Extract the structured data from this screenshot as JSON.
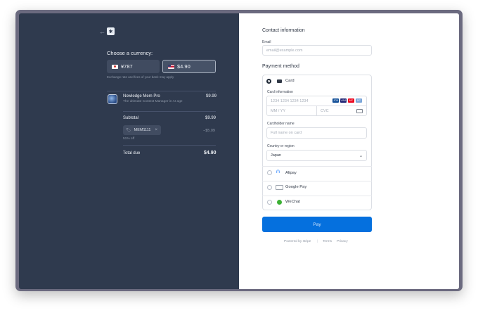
{
  "left": {
    "choose_label": "Choose a currency:",
    "currencies": [
      {
        "flag": "jp",
        "label": "¥787"
      },
      {
        "flag": "us",
        "label": "$4.90",
        "selected": true
      }
    ],
    "exchange_note": "Exchange rate and fees of your bank may apply",
    "product": {
      "name": "Nowledge Mem Pro",
      "desc": "The ultimate Context Manager in AI age",
      "price": "$9.99"
    },
    "subtotal_label": "Subtotal",
    "subtotal": "$9.99",
    "promo_code": "MEM1111",
    "promo_remove": "×",
    "discount": "−$5.09",
    "discount_note": "51% off",
    "total_label": "Total due",
    "total": "$4.90"
  },
  "right": {
    "contact_title": "Contact information",
    "email_label": "Email",
    "email_placeholder": "email@example.com",
    "payment_title": "Payment method",
    "card_label": "Card",
    "card_info_label": "Card information",
    "card_number_placeholder": "1234 1234 1234 1234",
    "expiry_placeholder": "MM / YY",
    "cvc_placeholder": "CVC",
    "cardholder_label": "Cardholder name",
    "cardholder_placeholder": "Full name on card",
    "country_label": "Country or region",
    "country_value": "Japan",
    "alipay_label": "Alipay",
    "gpay_label": "Google Pay",
    "wechat_label": "WeChat",
    "pay_button": "Pay",
    "powered_by": "Powered by stripe",
    "terms": "Terms",
    "privacy": "Privacy",
    "brand_badges": [
      "JCB",
      "VISA",
      "MC",
      "DC"
    ]
  },
  "colors": {
    "left_bg": "#2f3a4e",
    "pay_button": "#0570de"
  }
}
